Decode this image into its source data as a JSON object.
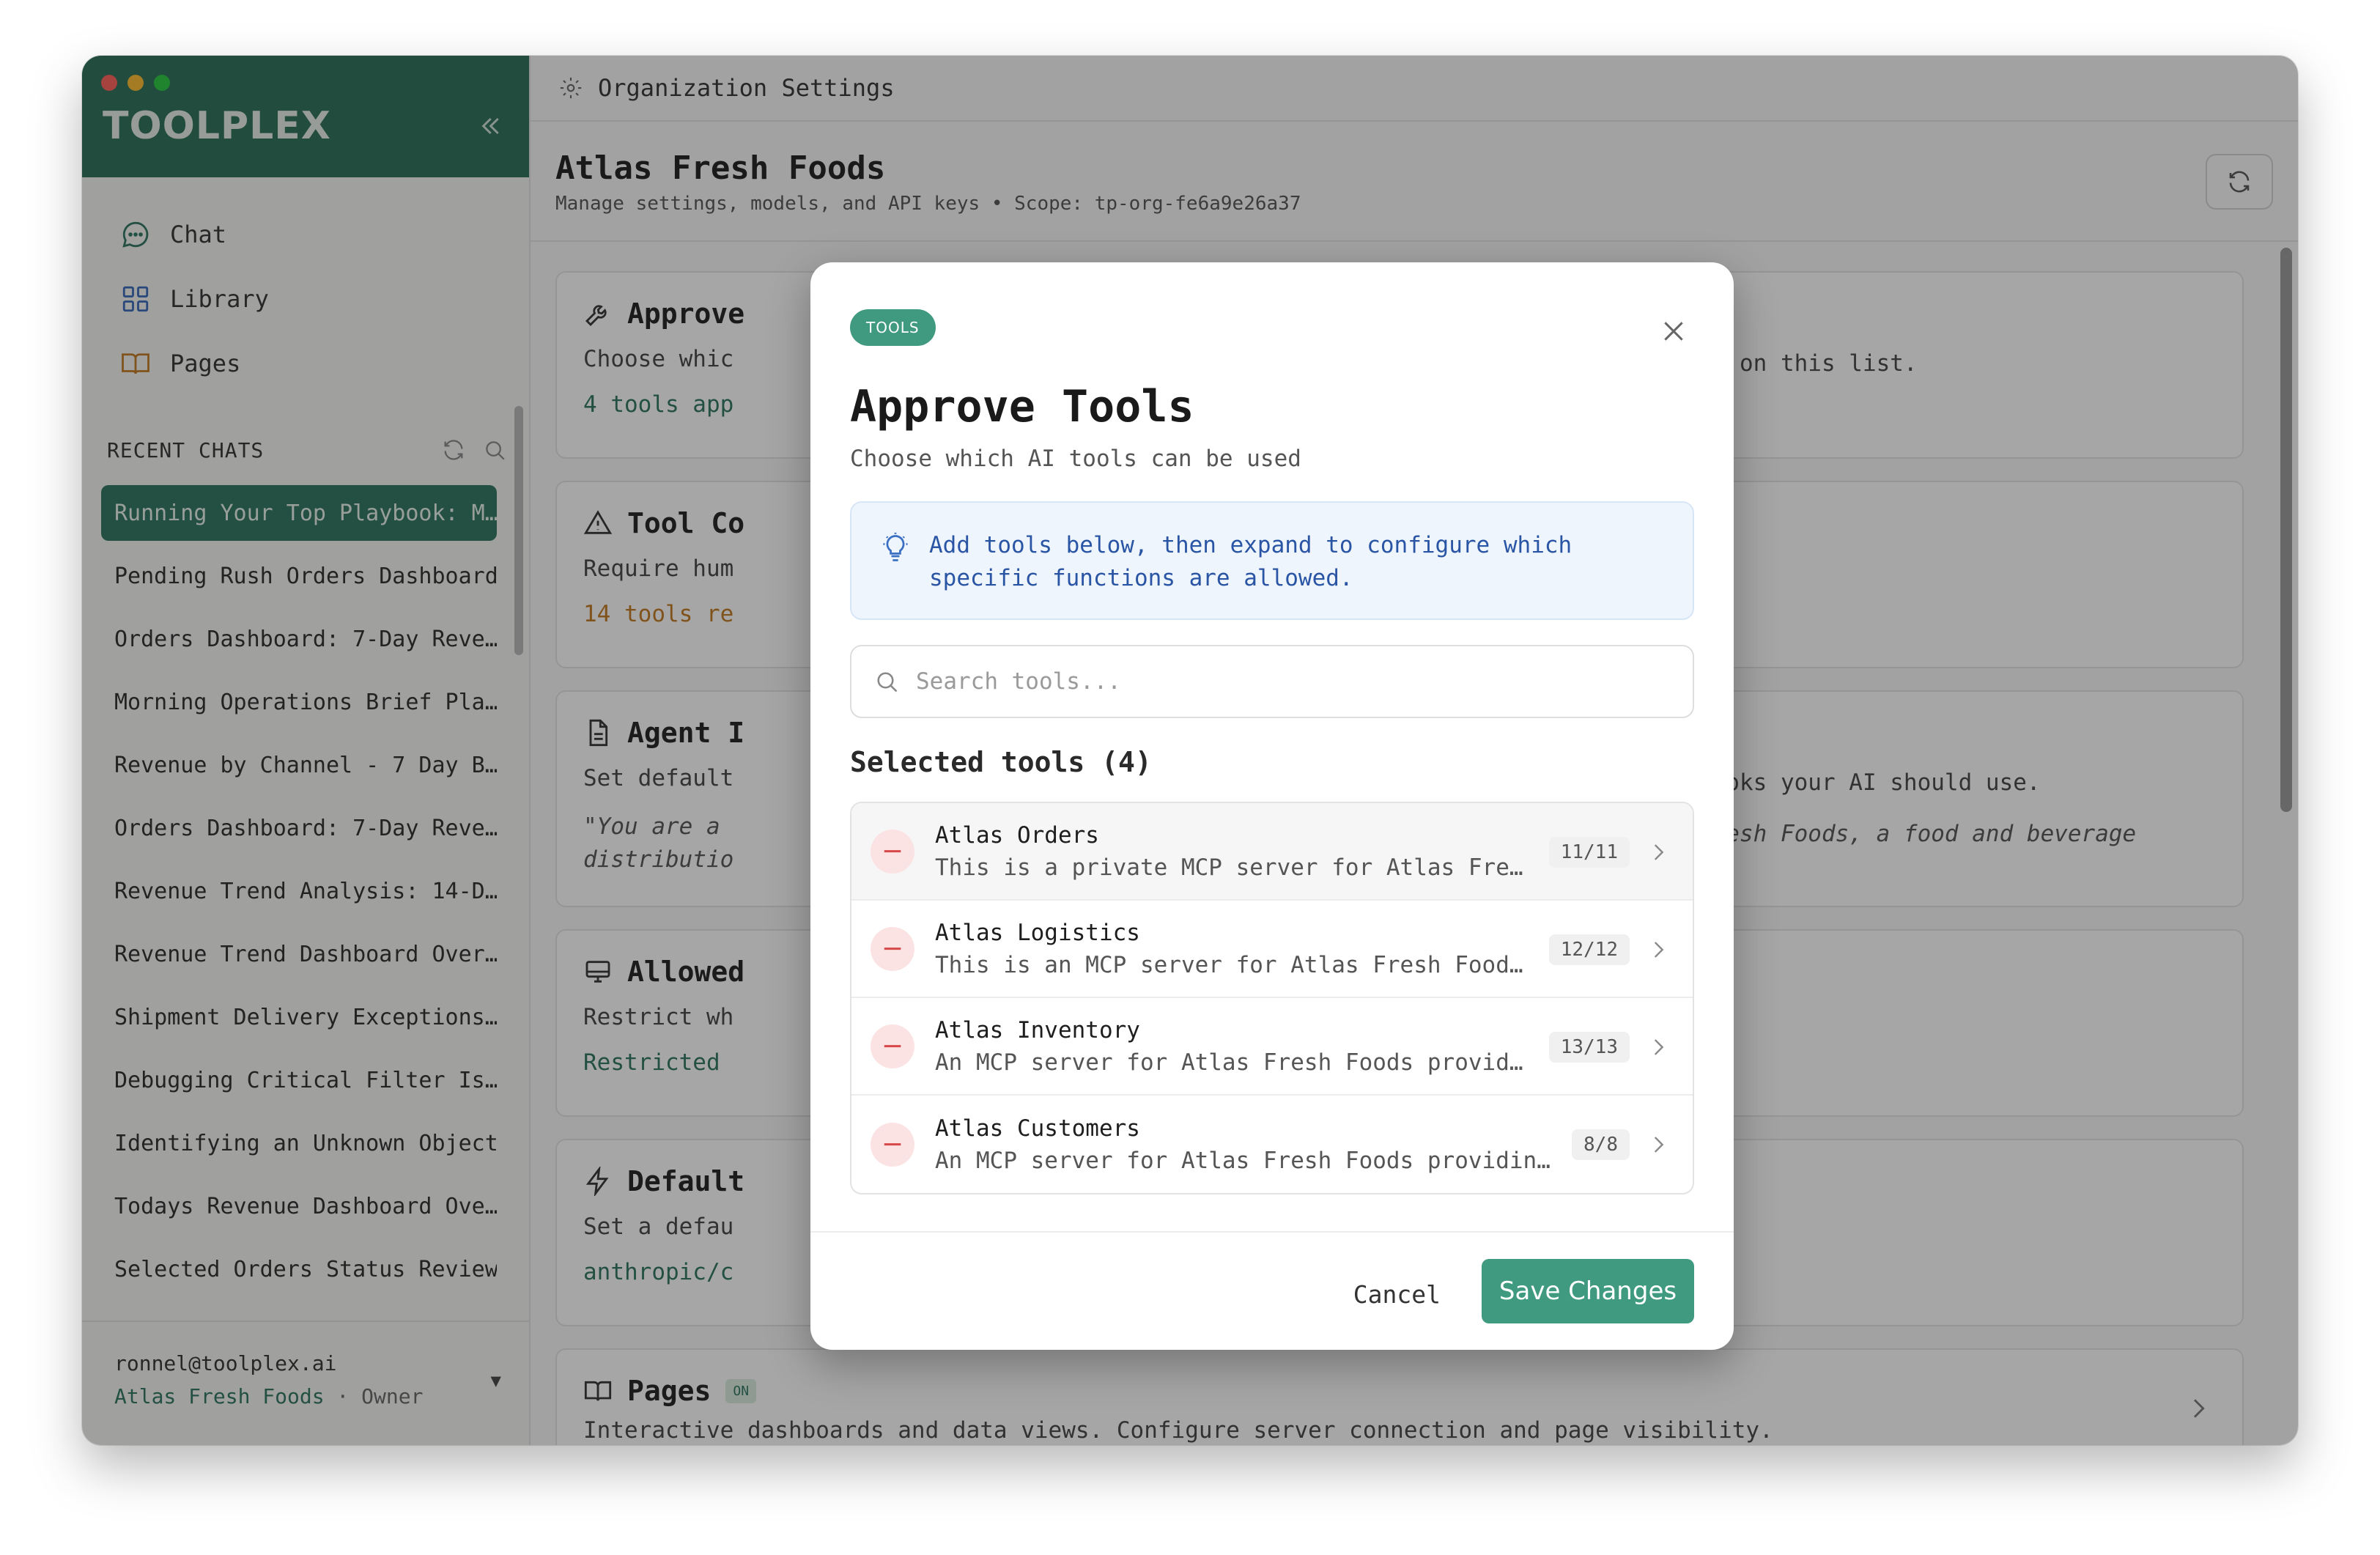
{
  "app": {
    "logo": "TOOLPLEX",
    "traffic_colors": [
      "#ff5f57",
      "#febc2e",
      "#28c840"
    ]
  },
  "sidebar": {
    "nav": [
      {
        "label": "Chat",
        "icon": "chat-bubble-icon"
      },
      {
        "label": "Library",
        "icon": "grid-icon"
      },
      {
        "label": "Pages",
        "icon": "book-icon"
      }
    ],
    "recent_title": "RECENT CHATS",
    "chats": [
      "Running Your Top Playbook: M…",
      "Pending Rush Orders Dashboard",
      "Orders Dashboard: 7-Day Reve…",
      "Morning Operations Brief Pla…",
      "Revenue by Channel - 7 Day B…",
      "Orders Dashboard: 7-Day Reve…",
      "Revenue Trend Analysis: 14-D…",
      "Revenue Trend Dashboard Over…",
      "Shipment Delivery Exceptions…",
      "Debugging Critical Filter Is…",
      "Identifying an Unknown Object",
      "Todays Revenue Dashboard Ove…",
      "Selected Orders Status Review"
    ],
    "user": {
      "email": "ronnel@toolplex.ai",
      "org": "Atlas Fresh Foods",
      "separator": " · ",
      "role": "Owner",
      "caret": "▼"
    }
  },
  "main": {
    "breadcrumb": "Organization Settings",
    "org_title": "Atlas Fresh Foods",
    "org_subtitle": "Manage settings, models, and API keys • Scope: tp-org-fe6a9e26a37",
    "cards": {
      "approve": {
        "title": "Approve",
        "desc": "Choose whic",
        "meta": "4 tools app",
        "right": "ools not on this list."
      },
      "tool_confirm": {
        "title": "Tool Co",
        "desc": "Require hum",
        "meta": "14 tools re"
      },
      "agent": {
        "title": "Agent I",
        "desc": "Set default",
        "quote": "\"You are a\ndistributio",
        "right": "d playbooks your AI should use.",
        "right_quote": "Atlas Fresh Foods, a food and beverage"
      },
      "allowed": {
        "title": "Allowed",
        "desc": "Restrict wh",
        "meta": "Restricted"
      },
      "default": {
        "title": "Default",
        "desc": "Set a defau",
        "meta": "anthropic/c"
      },
      "pages": {
        "title": "Pages",
        "badge": "ON",
        "desc": "Interactive dashboards and data views. Configure server connection and page visibility."
      }
    }
  },
  "modal": {
    "tag": "TOOLS",
    "title": "Approve Tools",
    "subtitle": "Choose which AI tools can be used",
    "info_line1": "Add tools below, then expand to configure which",
    "info_line2": "specific functions are allowed.",
    "search_placeholder": "Search tools...",
    "selected_heading": "Selected tools (4)",
    "tools": [
      {
        "name": "Atlas Orders",
        "desc": "This is a private MCP server for Atlas Fre…",
        "count": "11/11"
      },
      {
        "name": "Atlas Logistics",
        "desc": "This is an MCP server for Atlas Fresh Food…",
        "count": "12/12"
      },
      {
        "name": "Atlas Inventory",
        "desc": "An MCP server for Atlas Fresh Foods provid…",
        "count": "13/13"
      },
      {
        "name": "Atlas Customers",
        "desc": "An MCP server for Atlas Fresh Foods providin…",
        "count": "8/8"
      }
    ],
    "cancel_label": "Cancel",
    "save_label": "Save Changes"
  }
}
